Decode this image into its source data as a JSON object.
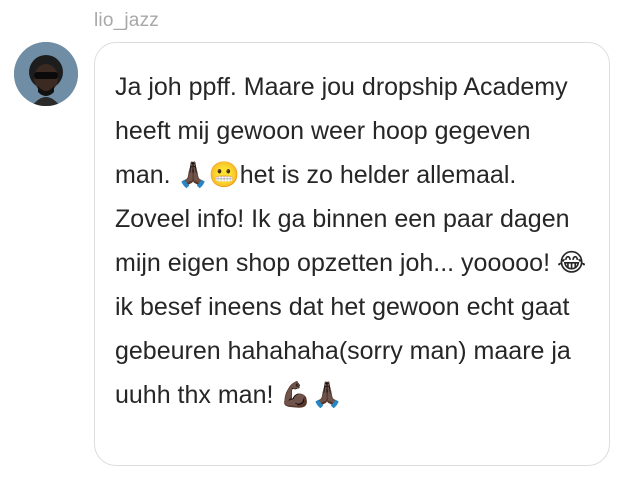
{
  "message": {
    "username": "lio_jazz",
    "text": "Ja joh ppff. Maare jou dropship Academy heeft mij gewoon weer hoop gegeven man. 🙏🏿😬het is zo helder allemaal. Zoveel info! Ik ga binnen een paar dagen mijn eigen shop opzetten joh... yooooo! 😂ik besef ineens dat het gewoon echt gaat gebeuren hahahaha(sorry man) maare ja uuhh thx man! 💪🏿🙏🏿"
  },
  "avatar": {
    "icon": "user-avatar-icon",
    "background_color": "#6f8ea6"
  },
  "colors": {
    "username": "#a8a8a8",
    "text": "#262626",
    "bubble_border": "#dcdcdc"
  }
}
